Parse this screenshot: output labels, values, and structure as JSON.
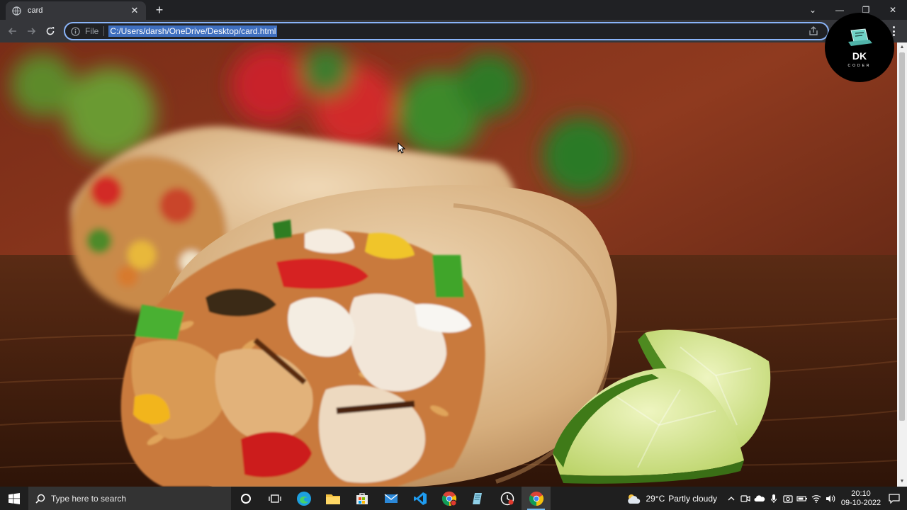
{
  "browser": {
    "tab_title": "card",
    "new_tab_symbol": "+",
    "tab_close_symbol": "✕",
    "address_scheme": "File",
    "address_url": "C:/Users/darsh/OneDrive/Desktop/card.html",
    "window_controls": {
      "minimize": "—",
      "maximize": "❐",
      "close": "✕",
      "tab_search": "⌄"
    }
  },
  "page": {
    "image_subject": "burrito-with-lime-photo"
  },
  "watermark": {
    "title": "DK",
    "subtitle": "CODER"
  },
  "taskbar": {
    "search_placeholder": "Type here to search",
    "weather_temp": "29°C",
    "weather_text": "Partly cloudy",
    "time": "20:10",
    "date": "09-10-2022",
    "pinned": [
      "cortana-icon",
      "task-view-icon",
      "edge-icon",
      "file-explorer-icon",
      "store-icon",
      "mail-icon",
      "vscode-icon",
      "chrome-profile-icon",
      "notepad-icon",
      "clock-app-icon",
      "chrome-icon"
    ],
    "accent_color": "#76b9ed"
  },
  "colors": {
    "omnibox_focus": "#8ab4f8",
    "chrome_dark": "#202124",
    "toolbar": "#35363a"
  }
}
